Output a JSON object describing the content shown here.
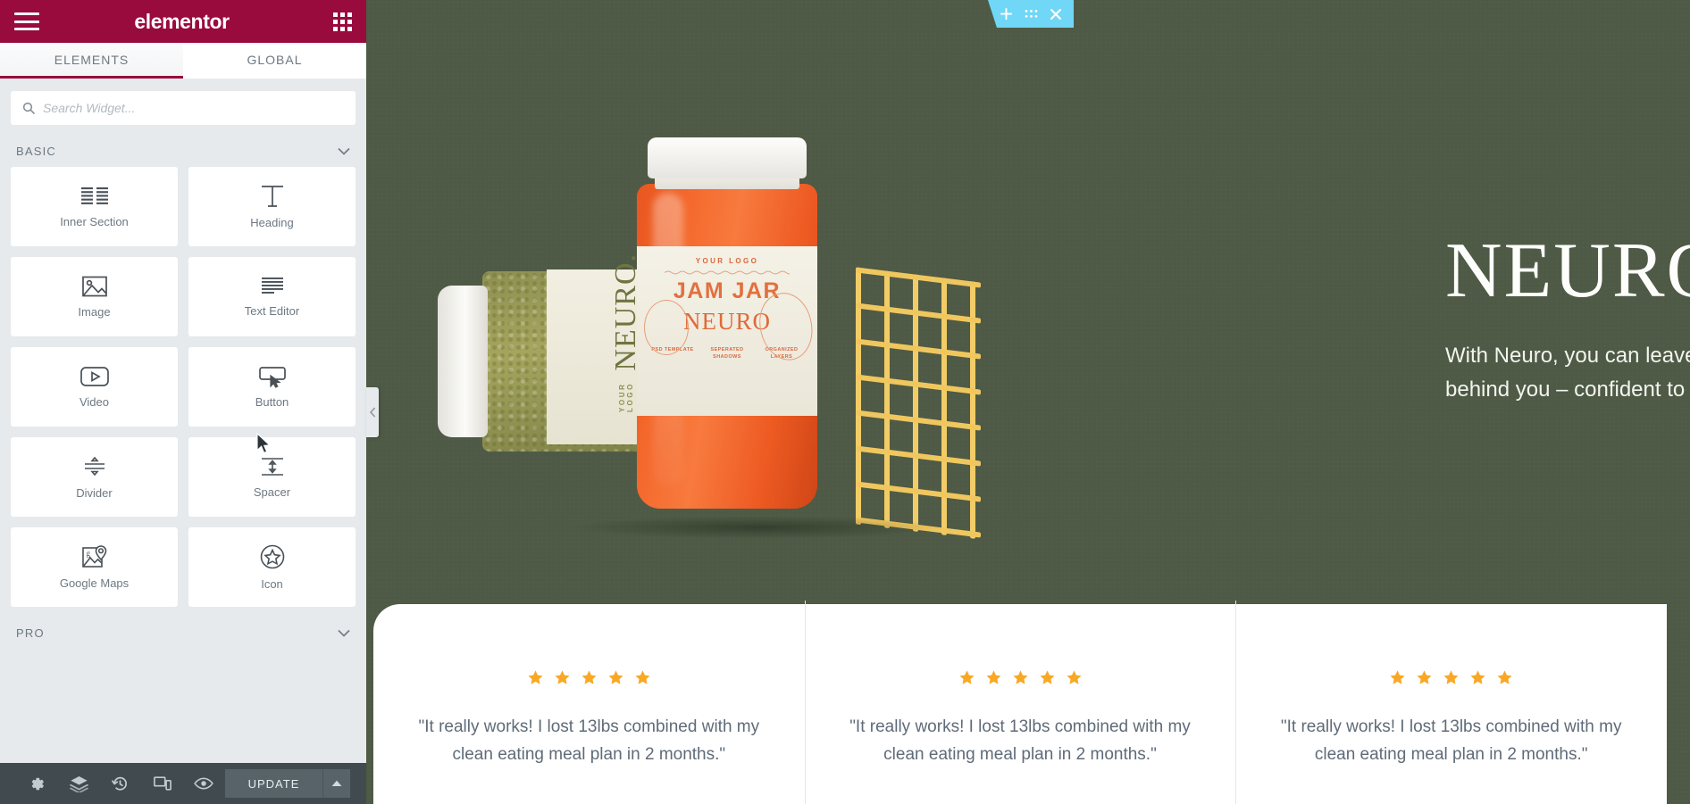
{
  "panel": {
    "brand": "elementor",
    "menu_icon": "hamburger-icon",
    "apps_icon": "apps-grid-icon",
    "tabs": [
      {
        "label": "ELEMENTS",
        "active": true
      },
      {
        "label": "GLOBAL",
        "active": false
      }
    ],
    "search": {
      "placeholder": "Search Widget...",
      "value": "",
      "icon": "search-icon"
    },
    "categories": [
      {
        "label": "BASIC",
        "expanded": true
      },
      {
        "label": "PRO",
        "expanded": false
      }
    ],
    "widgets": [
      {
        "label": "Inner Section",
        "icon": "inner-section-icon"
      },
      {
        "label": "Heading",
        "icon": "heading-icon"
      },
      {
        "label": "Image",
        "icon": "image-icon"
      },
      {
        "label": "Text Editor",
        "icon": "text-editor-icon"
      },
      {
        "label": "Video",
        "icon": "video-icon"
      },
      {
        "label": "Button",
        "icon": "button-icon"
      },
      {
        "label": "Divider",
        "icon": "divider-icon"
      },
      {
        "label": "Spacer",
        "icon": "spacer-icon"
      },
      {
        "label": "Google Maps",
        "icon": "google-maps-icon"
      },
      {
        "label": "Icon",
        "icon": "star-icon"
      }
    ],
    "bottom_bar": {
      "icons": [
        "settings-gear-icon",
        "navigator-layers-icon",
        "history-icon",
        "responsive-mode-icon",
        "preview-eye-icon"
      ],
      "update_label": "UPDATE",
      "caret_icon": "caret-up-icon"
    },
    "collapse_handle": "chevron-left-icon"
  },
  "canvas": {
    "section_toolbar": {
      "add_icon": "plus-icon",
      "drag_icon": "drag-handle-icon",
      "close_icon": "close-x-icon",
      "color": "#71d7f7"
    },
    "background_color": "#4e5a45",
    "hero": {
      "title": "NEURO",
      "subtitle": "With Neuro, you can leave your gluten-related anxiety behind you – confident to eat what you want."
    },
    "product": {
      "orange_jar": {
        "logo_text": "YOUR LOGO",
        "product_name": "JAM JAR",
        "brand": "NEURO",
        "features": [
          "PSD TEMPLATE",
          "SEPERATED SHADOWS",
          "ORGANIZED LAYERS"
        ]
      },
      "green_jar": {
        "logo_text": "YOUR LOGO",
        "brand": "NEURO."
      },
      "trellis_color": "#f0c75e"
    },
    "testimonials": [
      {
        "rating": 5,
        "quote": "\"It really works! I lost 13lbs combined with my clean eating meal plan in 2 months.\""
      },
      {
        "rating": 5,
        "quote": "\"It really works! I lost 13lbs combined with my clean eating meal plan in 2 months.\""
      },
      {
        "rating": 5,
        "quote": "\"It really works! I lost 13lbs combined with my clean eating meal plan in 2 months.\""
      }
    ],
    "star_color": "#f9a826"
  }
}
